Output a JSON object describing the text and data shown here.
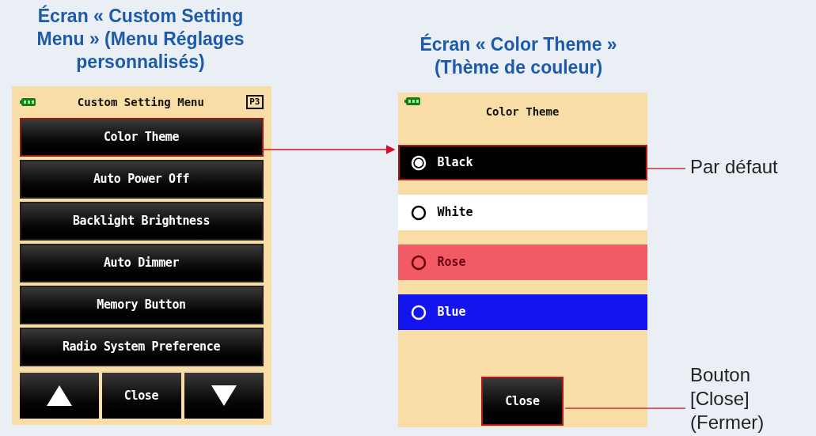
{
  "left_heading": "Écran « Custom Setting\nMenu » (Menu Réglages\npersonnalisés)",
  "right_heading": "Écran « Color Theme »\n(Thème de couleur)",
  "left_screen": {
    "title": "Custom Setting Menu",
    "page_badge": "P3",
    "menu_items": [
      {
        "label": "Color Theme",
        "selected": true
      },
      {
        "label": "Auto Power Off",
        "selected": false
      },
      {
        "label": "Backlight Brightness",
        "selected": false
      },
      {
        "label": "Auto Dimmer",
        "selected": false
      },
      {
        "label": "Memory Button",
        "selected": false
      },
      {
        "label": "Radio System Preference",
        "selected": false
      }
    ],
    "bottom_buttons": [
      {
        "kind": "up"
      },
      {
        "kind": "close",
        "label": "Close"
      },
      {
        "kind": "down"
      }
    ]
  },
  "right_screen": {
    "title": "Color Theme",
    "options": [
      {
        "label": "Black",
        "selected": true,
        "color": "#000000"
      },
      {
        "label": "White",
        "selected": false,
        "color": "#ffffff"
      },
      {
        "label": "Rose",
        "selected": false,
        "color": "#f25a64"
      },
      {
        "label": "Blue",
        "selected": false,
        "color": "#1414f0"
      }
    ],
    "close_button": "Close"
  },
  "annotations": [
    "Par défaut",
    "Bouton\n[Close]\n(Fermer)"
  ]
}
